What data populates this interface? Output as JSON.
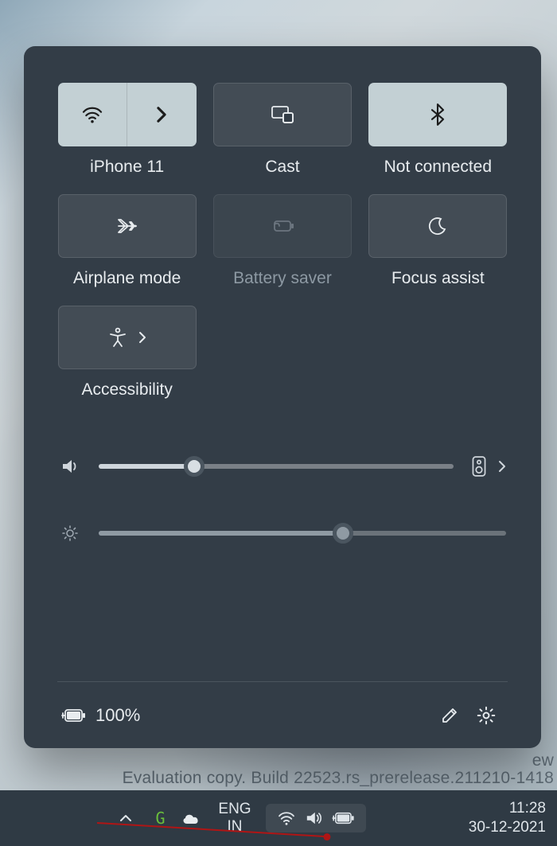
{
  "tiles": {
    "wifi": {
      "label": "iPhone 11"
    },
    "cast": {
      "label": "Cast"
    },
    "bluetooth": {
      "label": "Not connected"
    },
    "airplane": {
      "label": "Airplane mode"
    },
    "battery": {
      "label": "Battery saver"
    },
    "focus": {
      "label": "Focus assist"
    },
    "access": {
      "label": "Accessibility"
    }
  },
  "sliders": {
    "volume": {
      "percent": 27
    },
    "brightness": {
      "percent": 60
    }
  },
  "battery": {
    "text": "100%"
  },
  "watermark": {
    "line1": "ew",
    "line2": "Evaluation copy. Build 22523.rs_prerelease.211210-1418"
  },
  "taskbar": {
    "lang_top": "ENG",
    "lang_bottom": "IN",
    "time": "11:28",
    "date": "30-12-2021"
  }
}
